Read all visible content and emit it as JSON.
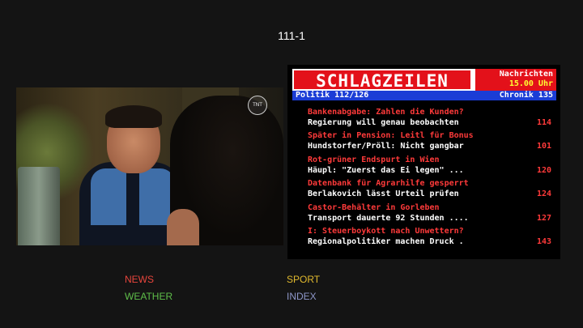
{
  "page_number": "111-1",
  "teletext": {
    "header_title": "SCHLAGZEILEN",
    "header_right_top": "Nachrichten",
    "header_right_bottom": "15.00 Uhr",
    "sub_left": "Politik 112/126",
    "sub_right": "Chronik 135",
    "items": [
      {
        "headline": "Bankenabgabe: Zahlen die Kunden?",
        "subline": "Regierung will genau beobachten",
        "page": "114"
      },
      {
        "headline": "Später in Pension: Leitl für Bonus",
        "subline": "Hundstorfer/Pröll: Nicht gangbar",
        "page": "101"
      },
      {
        "headline": "Rot-grüner Endspurt in Wien",
        "subline": "Häupl: \"Zuerst das Ei legen\" ...",
        "page": "120"
      },
      {
        "headline": "Datenbank für Agrarhilfe gesperrt",
        "subline": "Berlakovich lässt Urteil prüfen",
        "page": "124"
      },
      {
        "headline": "Castor-Behälter in Gorleben",
        "subline": "Transport dauerte 92 Stunden ....",
        "page": "127"
      },
      {
        "headline": "I: Steuerboykott nach Unwettern?",
        "subline": "Regionalpolitiker machen Druck .",
        "page": "143"
      }
    ]
  },
  "video": {
    "channel_logo": "TNT"
  },
  "nav": {
    "news": "NEWS",
    "sport": "SPORT",
    "weather": "WEATHER",
    "index": "INDEX"
  },
  "colors": {
    "news": "#e8453c",
    "sport": "#e0b92e",
    "weather": "#5fbf4a",
    "index": "#8e97c9",
    "teletext_red": "#e3111a",
    "teletext_blue": "#1b3dd6"
  }
}
